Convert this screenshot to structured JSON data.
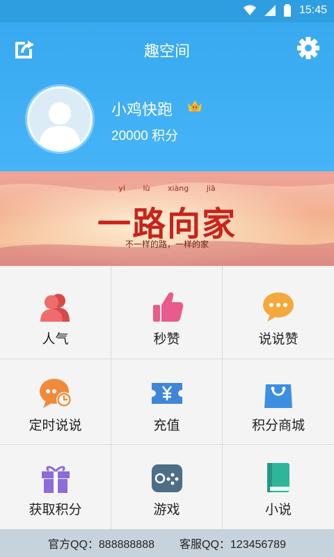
{
  "status_bar": {
    "time": "15:45"
  },
  "header": {
    "title": "趣空间",
    "username": "小鸡快跑",
    "points": "20000 积分"
  },
  "banner": {
    "title": "一路向家",
    "pinyin": "yí lù xiàng jiā",
    "subtitle": "不一样的路，一样的家"
  },
  "grid": [
    {
      "label": "人气",
      "icon": "popularity-icon",
      "color": "#e95b5b"
    },
    {
      "label": "秒赞",
      "icon": "thumbs-up-icon",
      "color": "#e95b8c"
    },
    {
      "label": "说说赞",
      "icon": "chat-bubble-icon",
      "color": "#f5a83b"
    },
    {
      "label": "定时说说",
      "icon": "scheduled-chat-icon",
      "color": "#f08a3a"
    },
    {
      "label": "充值",
      "icon": "recharge-icon",
      "color": "#3f86d9"
    },
    {
      "label": "积分商城",
      "icon": "shopping-bag-icon",
      "color": "#3c8fe0"
    },
    {
      "label": "获取积分",
      "icon": "gift-icon",
      "color": "#8b6cd8"
    },
    {
      "label": "游戏",
      "icon": "gamepad-icon",
      "color": "#4d6e86"
    },
    {
      "label": "小说",
      "icon": "book-icon",
      "color": "#2fb59a"
    }
  ],
  "footer": {
    "official_qq": "官方QQ：888888888",
    "service_qq": "客服QQ：123456789"
  }
}
